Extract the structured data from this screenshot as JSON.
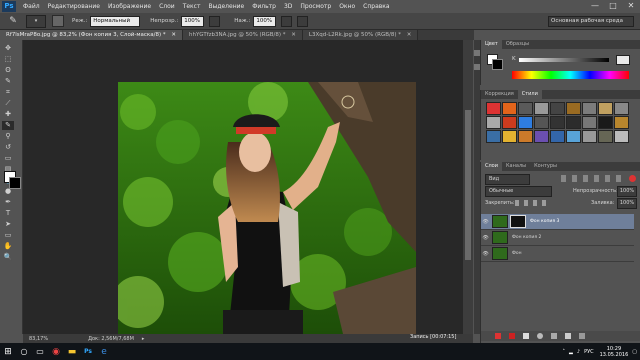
{
  "menubar": {
    "logo": "Ps",
    "items": [
      "Файл",
      "Редактирование",
      "Изображение",
      "Слои",
      "Текст",
      "Выделение",
      "Фильтр",
      "3D",
      "Просмотр",
      "Окно",
      "Справка"
    ],
    "win_minimize": "—",
    "win_maximize": "□",
    "win_close": "✕"
  },
  "optionsbar": {
    "mode_label": "Реж.:",
    "mode_value": "Нормальный",
    "opacity_label": "Непрозр.:",
    "opacity_value": "100%",
    "pressure_label": "Наж.:",
    "pressure_value": "100%",
    "workspace": "Основная рабочая среда"
  },
  "doc_tabs": [
    {
      "label": "Rf7lsMraP8o.jpg @ 83,2% (Фон копия 3, Слой-маска/8) *",
      "close": "✕"
    },
    {
      "label": "hhYGTfzb3NA.jpg @ 50% (RGB/8) *",
      "close": "✕"
    },
    {
      "label": "L3Xqd-L2Rk.jpg @ 50% (RGB/8) *",
      "close": "✕"
    }
  ],
  "status": {
    "zoom": "83,17%",
    "doc": "Док: 2,56M/7,68M"
  },
  "color_panel": {
    "tabs": [
      "Цвет",
      "Образцы"
    ],
    "k_label": "K"
  },
  "styles_panel": {
    "tabs": [
      "Коррекция",
      "Стили"
    ],
    "swatch_colors": [
      "#d33",
      "#e2641b",
      "#5a5a5a",
      "#999",
      "#444",
      "#9a6b22",
      "#7c7c7c",
      "#c0a060",
      "#888",
      "#aaa",
      "#cc3b1e",
      "#2e7de1",
      "#555",
      "#333",
      "#2c2c2c",
      "#777",
      "#1a1a1a",
      "#b8862d",
      "#3a6ea5",
      "#e3b230",
      "#cc7a2a",
      "#6b4fb0",
      "#3366aa",
      "#58a3d8",
      "#999",
      "#665",
      "#bbb"
    ]
  },
  "layers_panel": {
    "tabs": [
      "Слои",
      "Каналы",
      "Контуры"
    ],
    "kind_label": "Вид",
    "blend_mode": "Обычные",
    "opacity_label": "Непрозрачность:",
    "opacity_value": "100%",
    "lock_label": "Закрепить:",
    "fill_label": "Заливка:",
    "fill_value": "100%",
    "layers": [
      {
        "name": "Фон копия 3",
        "eye": "👁",
        "has_mask": true,
        "selected": true
      },
      {
        "name": "Фон копия 2",
        "eye": "👁",
        "has_mask": false,
        "selected": false
      },
      {
        "name": "Фон",
        "eye": "👁",
        "has_mask": false,
        "selected": false
      }
    ]
  },
  "recording": {
    "label": "Запись [00:07:15]"
  },
  "taskbar": {
    "lang": "РУС",
    "time": "10:29",
    "date": "13.05.2016"
  }
}
